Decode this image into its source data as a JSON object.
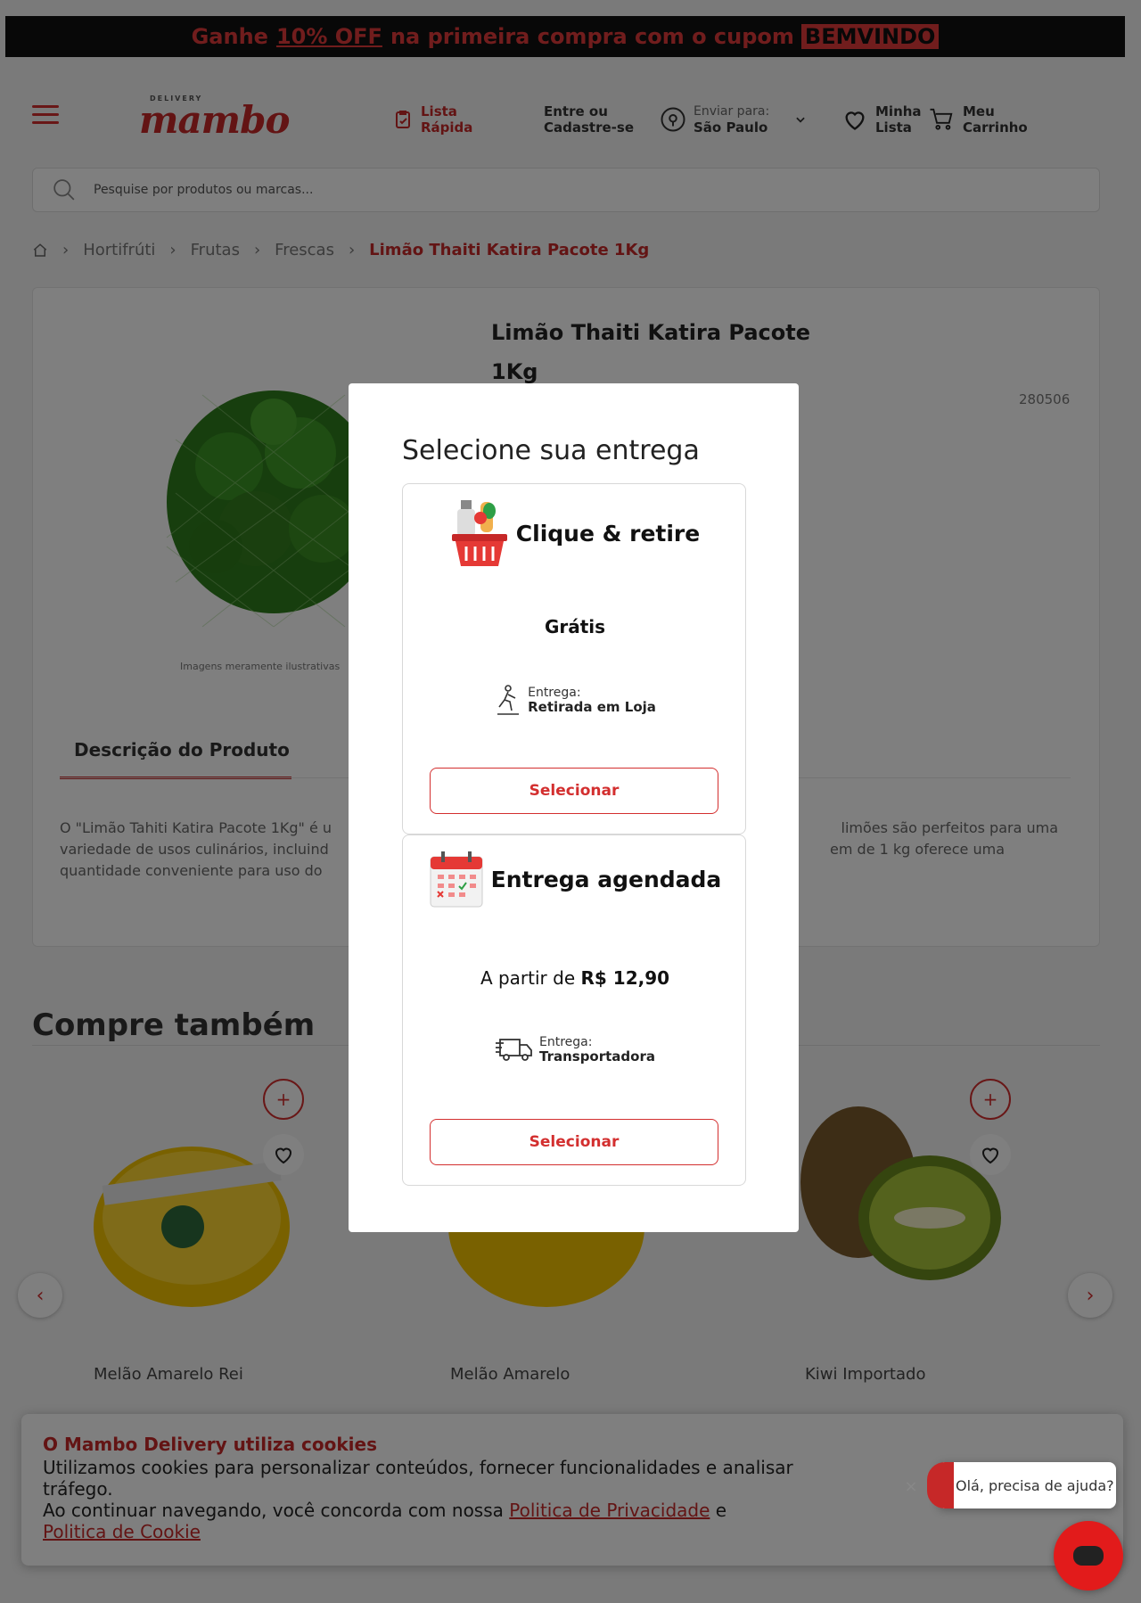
{
  "promo": {
    "prefix": "Ganhe",
    "highlight": "10% OFF",
    "middle": "na primeira compra com o cupom",
    "code": "BEMVINDO"
  },
  "header": {
    "logo_top": "DELIVERY",
    "logo": "mambo",
    "quick_list_l1": "Lista",
    "quick_list_l2": "Rápida",
    "login_l1": "Entre ou",
    "login_l2": "Cadastre-se",
    "ship_label": "Enviar para:",
    "ship_city": "São Paulo",
    "wishlist_l1": "Minha",
    "wishlist_l2": "Lista",
    "cart_l1": "Meu",
    "cart_l2": "Carrinho"
  },
  "search": {
    "placeholder": "Pesquise por produtos ou marcas..."
  },
  "breadcrumb": {
    "items": [
      "Hortifrúti",
      "Frutas",
      "Frescas"
    ],
    "current": "Limão Thaiti Katira Pacote 1Kg"
  },
  "product": {
    "title": "Limão Thaiti Katira Pacote 1Kg",
    "sku": "280506",
    "img_note": "Imagens meramente ilustrativas",
    "desc_tab": "Descrição do Produto",
    "desc_left": "O \"Limão Tahiti Katira Pacote 1Kg\" é u",
    "desc_left2": "variedade de usos culinários, incluind",
    "desc_left3": "quantidade conveniente para uso do",
    "desc_right": "limões são perfeitos para uma",
    "desc_right2": "em de 1 kg oferece uma"
  },
  "also": {
    "title": "Compre também",
    "items": [
      "Melão Amarelo Rei",
      "Melão Amarelo",
      "Kiwi Importado"
    ]
  },
  "cookie": {
    "title": "O Mambo Delivery utiliza cookies",
    "line1": "Utilizamos cookies para personalizar conteúdos, fornecer funcionalidades e analisar tráfego.",
    "line2": "Ao continuar navegando, você concorda com nossa",
    "privacy": "Politica de Privacidade",
    "and": "e",
    "cookie_policy": "Politica de Cookie"
  },
  "chat": {
    "bubble": "Olá, precisa de ajuda?"
  },
  "modal": {
    "title": "Selecione sua entrega",
    "options": [
      {
        "title": "Clique & retire",
        "price": "Grátis",
        "del_label": "Entrega:",
        "del_value": "Retirada em Loja",
        "button": "Selecionar"
      },
      {
        "title": "Entrega agendada",
        "price_prefix": "A partir de",
        "price": "R$ 12,90",
        "del_label": "Entrega:",
        "del_value": "Transportadora",
        "button": "Selecionar"
      }
    ]
  },
  "colors": {
    "brand_red": "#c62828",
    "accent_red": "#d32f2f",
    "promo_bg": "#111111"
  }
}
